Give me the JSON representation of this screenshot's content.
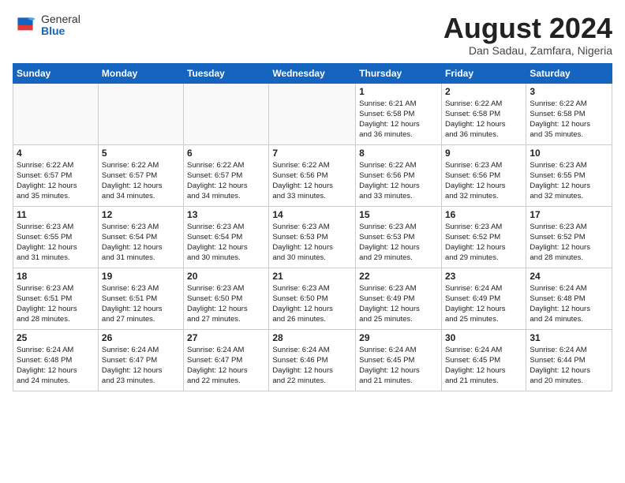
{
  "header": {
    "logo_general": "General",
    "logo_blue": "Blue",
    "month_year": "August 2024",
    "location": "Dan Sadau, Zamfara, Nigeria"
  },
  "days_of_week": [
    "Sunday",
    "Monday",
    "Tuesday",
    "Wednesday",
    "Thursday",
    "Friday",
    "Saturday"
  ],
  "weeks": [
    [
      {
        "day": "",
        "info": ""
      },
      {
        "day": "",
        "info": ""
      },
      {
        "day": "",
        "info": ""
      },
      {
        "day": "",
        "info": ""
      },
      {
        "day": "1",
        "info": "Sunrise: 6:21 AM\nSunset: 6:58 PM\nDaylight: 12 hours\nand 36 minutes."
      },
      {
        "day": "2",
        "info": "Sunrise: 6:22 AM\nSunset: 6:58 PM\nDaylight: 12 hours\nand 36 minutes."
      },
      {
        "day": "3",
        "info": "Sunrise: 6:22 AM\nSunset: 6:58 PM\nDaylight: 12 hours\nand 35 minutes."
      }
    ],
    [
      {
        "day": "4",
        "info": "Sunrise: 6:22 AM\nSunset: 6:57 PM\nDaylight: 12 hours\nand 35 minutes."
      },
      {
        "day": "5",
        "info": "Sunrise: 6:22 AM\nSunset: 6:57 PM\nDaylight: 12 hours\nand 34 minutes."
      },
      {
        "day": "6",
        "info": "Sunrise: 6:22 AM\nSunset: 6:57 PM\nDaylight: 12 hours\nand 34 minutes."
      },
      {
        "day": "7",
        "info": "Sunrise: 6:22 AM\nSunset: 6:56 PM\nDaylight: 12 hours\nand 33 minutes."
      },
      {
        "day": "8",
        "info": "Sunrise: 6:22 AM\nSunset: 6:56 PM\nDaylight: 12 hours\nand 33 minutes."
      },
      {
        "day": "9",
        "info": "Sunrise: 6:23 AM\nSunset: 6:56 PM\nDaylight: 12 hours\nand 32 minutes."
      },
      {
        "day": "10",
        "info": "Sunrise: 6:23 AM\nSunset: 6:55 PM\nDaylight: 12 hours\nand 32 minutes."
      }
    ],
    [
      {
        "day": "11",
        "info": "Sunrise: 6:23 AM\nSunset: 6:55 PM\nDaylight: 12 hours\nand 31 minutes."
      },
      {
        "day": "12",
        "info": "Sunrise: 6:23 AM\nSunset: 6:54 PM\nDaylight: 12 hours\nand 31 minutes."
      },
      {
        "day": "13",
        "info": "Sunrise: 6:23 AM\nSunset: 6:54 PM\nDaylight: 12 hours\nand 30 minutes."
      },
      {
        "day": "14",
        "info": "Sunrise: 6:23 AM\nSunset: 6:53 PM\nDaylight: 12 hours\nand 30 minutes."
      },
      {
        "day": "15",
        "info": "Sunrise: 6:23 AM\nSunset: 6:53 PM\nDaylight: 12 hours\nand 29 minutes."
      },
      {
        "day": "16",
        "info": "Sunrise: 6:23 AM\nSunset: 6:52 PM\nDaylight: 12 hours\nand 29 minutes."
      },
      {
        "day": "17",
        "info": "Sunrise: 6:23 AM\nSunset: 6:52 PM\nDaylight: 12 hours\nand 28 minutes."
      }
    ],
    [
      {
        "day": "18",
        "info": "Sunrise: 6:23 AM\nSunset: 6:51 PM\nDaylight: 12 hours\nand 28 minutes."
      },
      {
        "day": "19",
        "info": "Sunrise: 6:23 AM\nSunset: 6:51 PM\nDaylight: 12 hours\nand 27 minutes."
      },
      {
        "day": "20",
        "info": "Sunrise: 6:23 AM\nSunset: 6:50 PM\nDaylight: 12 hours\nand 27 minutes."
      },
      {
        "day": "21",
        "info": "Sunrise: 6:23 AM\nSunset: 6:50 PM\nDaylight: 12 hours\nand 26 minutes."
      },
      {
        "day": "22",
        "info": "Sunrise: 6:23 AM\nSunset: 6:49 PM\nDaylight: 12 hours\nand 25 minutes."
      },
      {
        "day": "23",
        "info": "Sunrise: 6:24 AM\nSunset: 6:49 PM\nDaylight: 12 hours\nand 25 minutes."
      },
      {
        "day": "24",
        "info": "Sunrise: 6:24 AM\nSunset: 6:48 PM\nDaylight: 12 hours\nand 24 minutes."
      }
    ],
    [
      {
        "day": "25",
        "info": "Sunrise: 6:24 AM\nSunset: 6:48 PM\nDaylight: 12 hours\nand 24 minutes."
      },
      {
        "day": "26",
        "info": "Sunrise: 6:24 AM\nSunset: 6:47 PM\nDaylight: 12 hours\nand 23 minutes."
      },
      {
        "day": "27",
        "info": "Sunrise: 6:24 AM\nSunset: 6:47 PM\nDaylight: 12 hours\nand 22 minutes."
      },
      {
        "day": "28",
        "info": "Sunrise: 6:24 AM\nSunset: 6:46 PM\nDaylight: 12 hours\nand 22 minutes."
      },
      {
        "day": "29",
        "info": "Sunrise: 6:24 AM\nSunset: 6:45 PM\nDaylight: 12 hours\nand 21 minutes."
      },
      {
        "day": "30",
        "info": "Sunrise: 6:24 AM\nSunset: 6:45 PM\nDaylight: 12 hours\nand 21 minutes."
      },
      {
        "day": "31",
        "info": "Sunrise: 6:24 AM\nSunset: 6:44 PM\nDaylight: 12 hours\nand 20 minutes."
      }
    ]
  ]
}
